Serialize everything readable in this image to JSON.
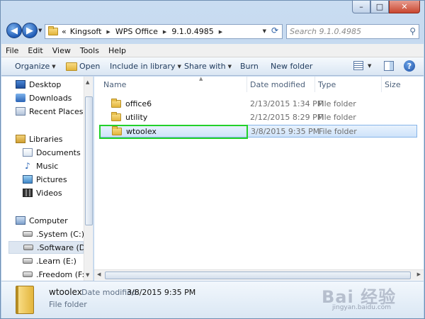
{
  "window": {
    "caption": {
      "minimize": "–",
      "maximize": "□",
      "close": "✕"
    }
  },
  "address": {
    "overflow": "«",
    "crumbs": [
      "Kingsoft",
      "WPS Office",
      "9.1.0.4985"
    ],
    "refresh": "⟳",
    "search_placeholder": "Search 9.1.0.4985"
  },
  "menu": [
    "File",
    "Edit",
    "View",
    "Tools",
    "Help"
  ],
  "toolbar": {
    "organize": "Organize",
    "open": "Open",
    "include": "Include in library",
    "share": "Share with",
    "burn": "Burn",
    "new_folder": "New folder",
    "help": "?"
  },
  "nav": {
    "favorites": [
      "Desktop",
      "Downloads",
      "Recent Places"
    ],
    "libraries_label": "Libraries",
    "libraries": [
      "Documents",
      "Music",
      "Pictures",
      "Videos"
    ],
    "computer_label": "Computer",
    "drives": [
      ".System (C:)",
      ".Software (D:)",
      ".Learn (E:)",
      ".Freedom (F:)"
    ]
  },
  "columns": {
    "name": "Name",
    "date": "Date modified",
    "type": "Type",
    "size": "Size"
  },
  "files": [
    {
      "name": "office6",
      "date": "2/13/2015 1:34 PM",
      "type": "File folder"
    },
    {
      "name": "utility",
      "date": "2/12/2015 8:29 PM",
      "type": "File folder"
    },
    {
      "name": "wtoolex",
      "date": "3/8/2015 9:35 PM",
      "type": "File folder"
    }
  ],
  "details": {
    "name": "wtoolex",
    "date_label": "Date modified:",
    "date": "3/8/2015 9:35 PM",
    "type": "File folder"
  },
  "watermark": {
    "main": "Bai 经验",
    "sub": "jingyan.baidu.com"
  },
  "colors": {
    "highlight": "#22d12a",
    "selection": "#cfe3fa"
  }
}
